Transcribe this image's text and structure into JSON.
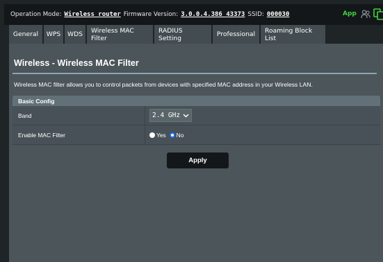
{
  "status_bar": {
    "operation_mode_label": "Operation Mode:",
    "operation_mode_value": "Wireless router",
    "firmware_label": "Firmware Version:",
    "firmware_value": "3.0.0.4.386_43373",
    "ssid_label": "SSID:",
    "ssid_value": "000030",
    "app_label": "App",
    "app_color": "#3fd43f",
    "icons": [
      "users-icon",
      "copy-icon"
    ]
  },
  "tabs": [
    {
      "label": "General"
    },
    {
      "label": "WPS"
    },
    {
      "label": "WDS"
    },
    {
      "label": "Wireless MAC Filter",
      "active": true
    },
    {
      "label": "RADIUS Setting"
    },
    {
      "label": "Professional"
    },
    {
      "label": "Roaming Block List"
    }
  ],
  "page": {
    "title": "Wireless - Wireless MAC Filter",
    "description": "Wireless MAC filter allows you to control packets from devices with specified MAC address in your Wireless LAN."
  },
  "basic_config": {
    "header": "Basic Config",
    "band_label": "Band",
    "band_value": "2.4 GHz",
    "enable_label": "Enable MAC Filter",
    "yes_label": "Yes",
    "no_label": "No",
    "selected": "No"
  },
  "apply_label": "Apply"
}
